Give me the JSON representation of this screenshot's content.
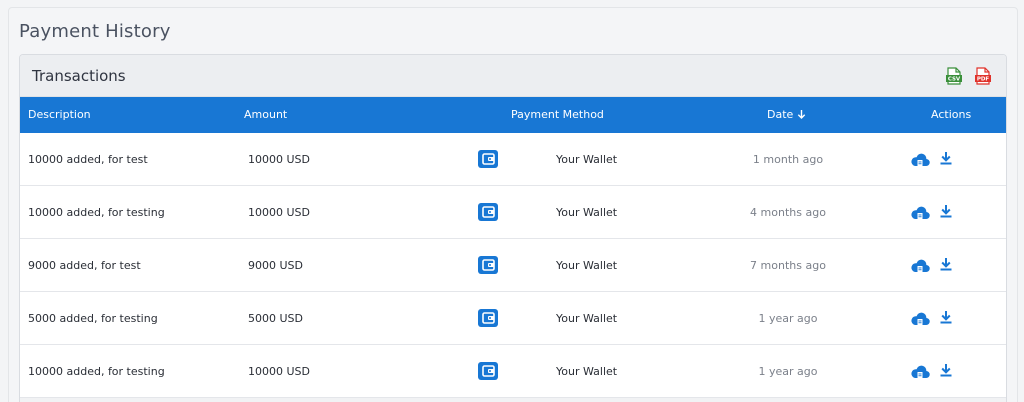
{
  "page": {
    "title": "Payment History"
  },
  "card": {
    "title": "Transactions",
    "exports": [
      {
        "icon": "csv-file-icon",
        "color": "#3a8f3a"
      },
      {
        "icon": "pdf-file-icon",
        "color": "#e0322b"
      }
    ]
  },
  "table": {
    "header_color": "#1877d4",
    "columns": {
      "description": "Description",
      "amount": "Amount",
      "payment_method": "Payment Method",
      "date": "Date",
      "actions": "Actions"
    },
    "sort_icon": "arrow-down-icon",
    "rows": [
      {
        "description": "10000 added, for test",
        "amount": "10000 USD",
        "method": "Your Wallet",
        "date": "1 month ago"
      },
      {
        "description": "10000 added, for testing",
        "amount": "10000 USD",
        "method": "Your Wallet",
        "date": "4 months ago"
      },
      {
        "description": "9000 added, for test",
        "amount": "9000 USD",
        "method": "Your Wallet",
        "date": "7 months ago"
      },
      {
        "description": "5000 added, for testing",
        "amount": "5000 USD",
        "method": "Your Wallet",
        "date": "1 year ago"
      },
      {
        "description": "10000 added, for testing",
        "amount": "10000 USD",
        "method": "Your Wallet",
        "date": "1 year ago"
      }
    ],
    "row_icons": {
      "method": "wallet-icon",
      "action_1": "cloud-invoice-icon",
      "action_2": "download-icon",
      "accent": "#1877d4"
    }
  }
}
